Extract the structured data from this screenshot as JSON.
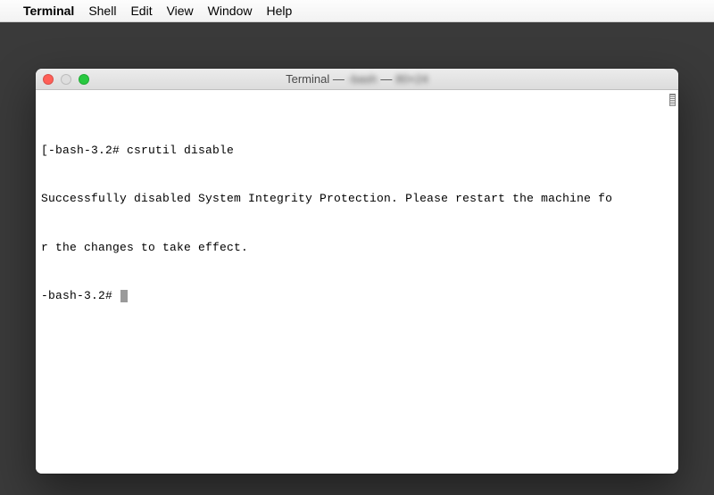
{
  "menubar": {
    "app_name": "Terminal",
    "items": [
      "Shell",
      "Edit",
      "View",
      "Window",
      "Help"
    ]
  },
  "window": {
    "title_prefix": "Terminal — ",
    "title_obscured_1": "-bash",
    "title_sep": " — ",
    "title_obscured_2": "80×24"
  },
  "terminal": {
    "line1_prefix": "[",
    "line1_prompt": "-bash-3.2# ",
    "line1_cmd": "csrutil disable",
    "line2": "Successfully disabled System Integrity Protection. Please restart the machine fo",
    "line3": "r the changes to take effect.",
    "line4_prompt": "-bash-3.2# "
  }
}
